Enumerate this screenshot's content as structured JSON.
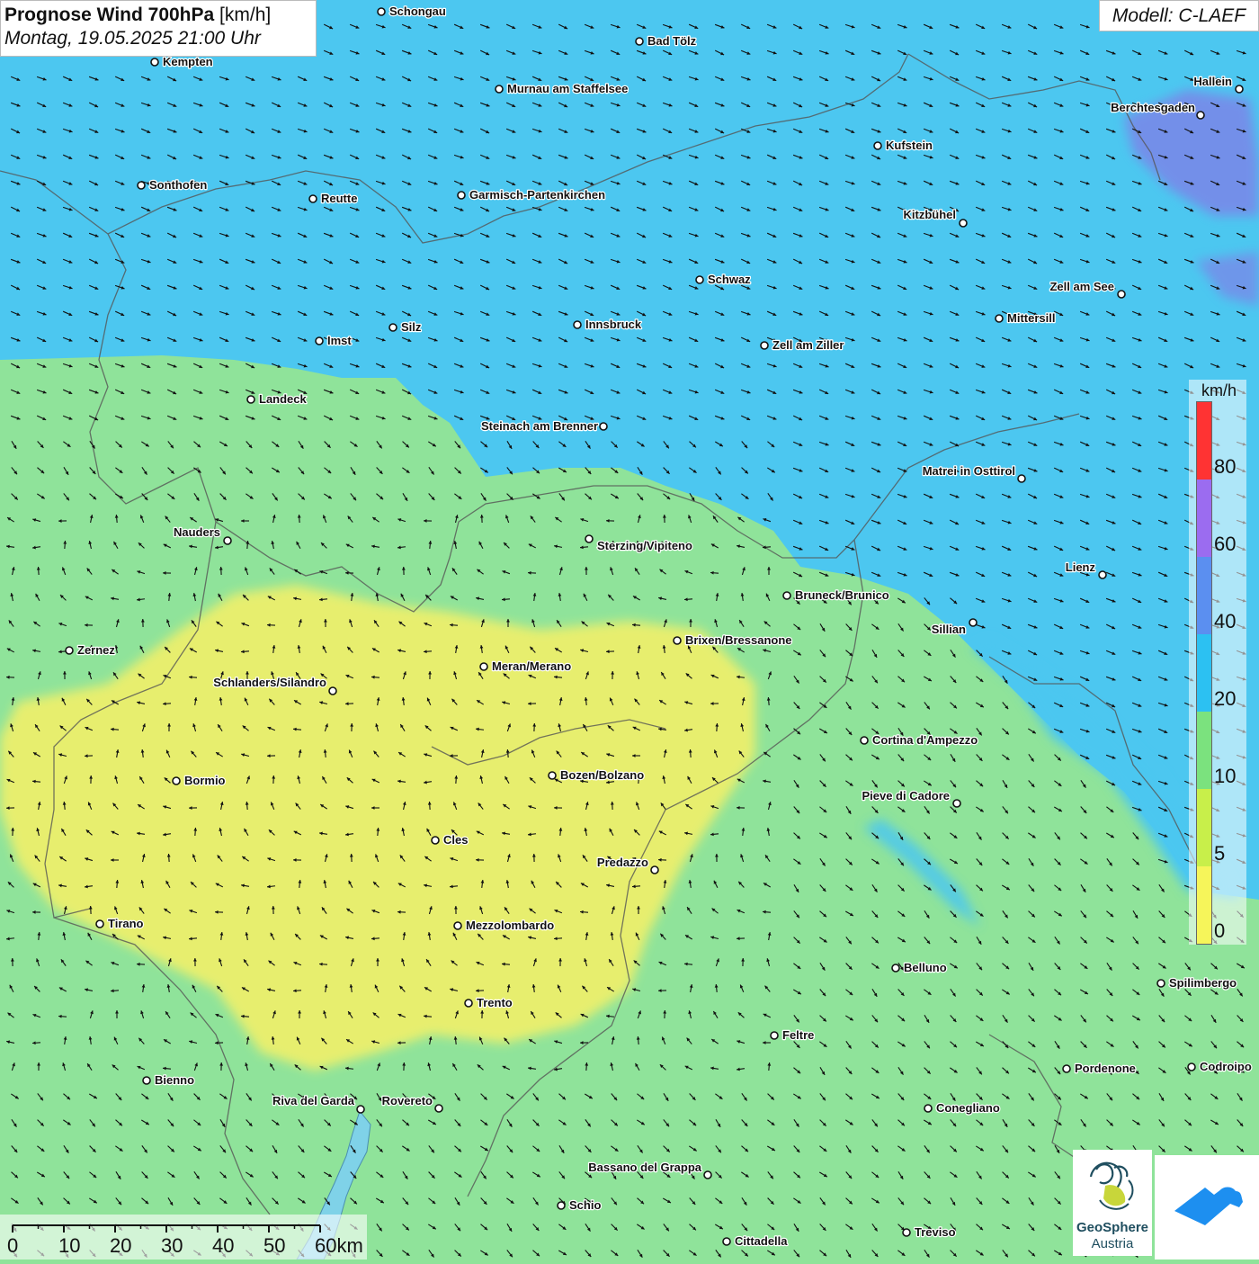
{
  "header": {
    "title_bold": "Prognose Wind 700hPa",
    "title_unit": "[km/h]",
    "datetime": "Montag, 19.05.2025 21:00 Uhr",
    "model": "Modell: C-LAEF"
  },
  "legend": {
    "unit": "km/h",
    "labels": [
      "80",
      "60",
      "40",
      "20",
      "10",
      "5",
      "0"
    ],
    "colors": [
      "#ff3333",
      "#9b6cf0",
      "#5b8ff0",
      "#2cc1f2",
      "#7be27e",
      "#c8ef4a",
      "#f6f55a"
    ]
  },
  "scale": {
    "labels": [
      "0",
      "10",
      "20",
      "30",
      "40",
      "50",
      "60km"
    ]
  },
  "logos": {
    "geosphere_line1": "GeoSphere",
    "geosphere_line2": "Austria",
    "app_icon": "geosphere-app-icon"
  },
  "colors": {
    "calm_yellow": "#f4f36b",
    "light_green": "#8fe39a",
    "wind_blue": "#4cc7f0",
    "strong_violet": "#7a86e8",
    "arrow": "#111111"
  },
  "cities": [
    {
      "name": "Schongau",
      "anchor": "start"
    },
    {
      "name": "Bad Tölz",
      "anchor": "start"
    },
    {
      "name": "Kempten",
      "anchor": "start"
    },
    {
      "name": "Murnau am Staffelsee",
      "anchor": "start"
    },
    {
      "name": "Hallein",
      "anchor": "end"
    },
    {
      "name": "Berchtesgaden",
      "anchor": "end"
    },
    {
      "name": "Kufstein",
      "anchor": "start"
    },
    {
      "name": "Sonthofen",
      "anchor": "start"
    },
    {
      "name": "Reutte",
      "anchor": "start"
    },
    {
      "name": "Garmisch-Partenkirchen",
      "anchor": "start"
    },
    {
      "name": "Kitzbühel",
      "anchor": "end"
    },
    {
      "name": "Schwaz",
      "anchor": "start"
    },
    {
      "name": "Zell am See",
      "anchor": "end"
    },
    {
      "name": "Mittersill",
      "anchor": "start"
    },
    {
      "name": "Innsbruck",
      "anchor": "start"
    },
    {
      "name": "Silz",
      "anchor": "start"
    },
    {
      "name": "Imst",
      "anchor": "start"
    },
    {
      "name": "Zell am Ziller",
      "anchor": "start"
    },
    {
      "name": "Landeck",
      "anchor": "start"
    },
    {
      "name": "Steinach am Brenner",
      "anchor": "end"
    },
    {
      "name": "Matrei in Osttirol",
      "anchor": "end"
    },
    {
      "name": "Nauders",
      "anchor": "end"
    },
    {
      "name": "Sterzing/Vipiteno",
      "anchor": "start"
    },
    {
      "name": "Lienz",
      "anchor": "end"
    },
    {
      "name": "Bruneck/Brunico",
      "anchor": "start"
    },
    {
      "name": "Sillian",
      "anchor": "end"
    },
    {
      "name": "Zernez",
      "anchor": "start"
    },
    {
      "name": "Brixen/Bressanone",
      "anchor": "start"
    },
    {
      "name": "Meran/Merano",
      "anchor": "start"
    },
    {
      "name": "Schlanders/Silandro",
      "anchor": "end"
    },
    {
      "name": "Cortina d'Ampezzo",
      "anchor": "start"
    },
    {
      "name": "Bozen/Bolzano",
      "anchor": "start"
    },
    {
      "name": "Bormio",
      "anchor": "start"
    },
    {
      "name": "Pieve di Cadore",
      "anchor": "end"
    },
    {
      "name": "Cles",
      "anchor": "start"
    },
    {
      "name": "Predazzo",
      "anchor": "end"
    },
    {
      "name": "Tirano",
      "anchor": "start"
    },
    {
      "name": "Mezzolombardo",
      "anchor": "start"
    },
    {
      "name": "Belluno",
      "anchor": "start"
    },
    {
      "name": "Spilimbergo",
      "anchor": "start"
    },
    {
      "name": "Trento",
      "anchor": "start"
    },
    {
      "name": "Feltre",
      "anchor": "start"
    },
    {
      "name": "Pordenone",
      "anchor": "start"
    },
    {
      "name": "Codroipo",
      "anchor": "start"
    },
    {
      "name": "Bienno",
      "anchor": "start"
    },
    {
      "name": "Riva del Garda",
      "anchor": "end"
    },
    {
      "name": "Rovereto",
      "anchor": "end"
    },
    {
      "name": "Conegliano",
      "anchor": "start"
    },
    {
      "name": "Bassano del Grappa",
      "anchor": "end"
    },
    {
      "name": "Schio",
      "anchor": "start"
    },
    {
      "name": "Treviso",
      "anchor": "start"
    },
    {
      "name": "Cittadella",
      "anchor": "start"
    }
  ]
}
